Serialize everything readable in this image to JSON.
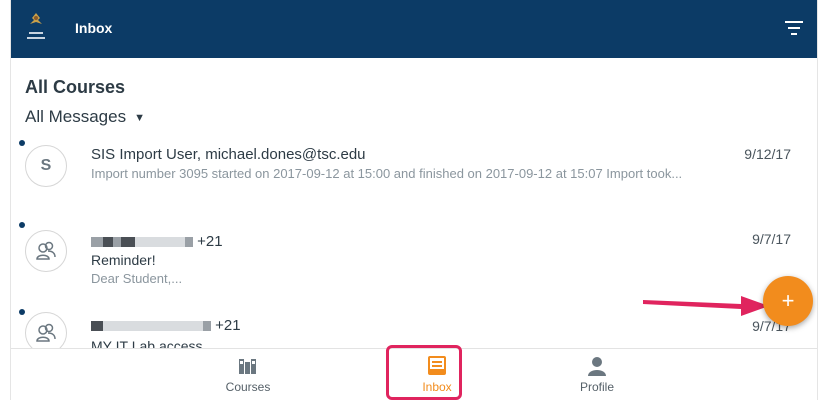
{
  "topbar": {
    "title": "Inbox",
    "logo_icon": "school-logo-icon",
    "filter_icon": "filter-icon",
    "background": "#0c3b66"
  },
  "header": {
    "course_title": "All Courses",
    "filter_label": "All Messages",
    "filter_caret": "▼"
  },
  "messages": [
    {
      "avatar": "S",
      "participants": "SIS Import User, michael.dones@tsc.edu",
      "subject": "",
      "preview": "Import number 3095 started on 2017-09-12 at 15:00 and finished on 2017-09-12 at 15:07 Import took...",
      "date": "9/12/17",
      "unread": true
    },
    {
      "avatar": "group-icon",
      "participants_suffix": "+21",
      "subject": "Reminder!",
      "preview": "Dear Student,...",
      "date": "9/7/17",
      "unread": true
    },
    {
      "avatar": "group-icon",
      "participants_suffix": "+21",
      "subject": "MY IT Lab access",
      "preview": "",
      "date": "9/7/17",
      "unread": true
    }
  ],
  "fab": {
    "label": "+",
    "color": "#f28c1d"
  },
  "annotation": {
    "arrow_color": "#e0245e"
  },
  "bottom_nav": {
    "items": [
      {
        "label": "Courses",
        "icon": "courses-icon"
      },
      {
        "label": "Inbox",
        "icon": "inbox-icon",
        "active": true
      },
      {
        "label": "Profile",
        "icon": "profile-icon"
      }
    ],
    "active_color": "#f28c1d"
  }
}
